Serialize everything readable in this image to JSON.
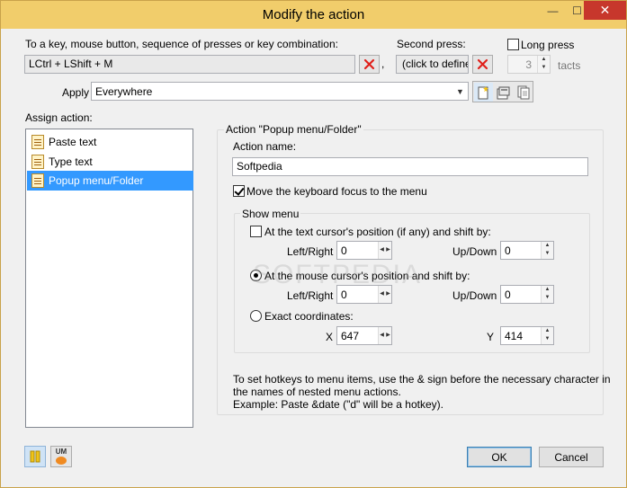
{
  "window": {
    "title": "Modify the action",
    "minimize_glyph": "—",
    "maximize_glyph": "☐",
    "close_glyph": "✕"
  },
  "top": {
    "key_label": "To a key, mouse button, sequence of presses or key combination:",
    "key_value": "LCtrl + LShift + M",
    "comma": ",",
    "second_press_label": "Second press:",
    "second_press_value": "(click to define)",
    "long_press_label": "Long press",
    "long_press_checked": false,
    "tacts_value": "3",
    "tacts_label": "tacts"
  },
  "apply": {
    "label": "Apply",
    "value": "Everywhere",
    "icons": [
      "new-icon",
      "properties-icon",
      "copy-icon"
    ]
  },
  "assign": {
    "label": "Assign action:",
    "items": [
      {
        "label": "Paste text",
        "icon": "paste-text-icon",
        "selected": false
      },
      {
        "label": "Type text",
        "icon": "type-text-icon",
        "selected": false
      },
      {
        "label": "Popup menu/Folder",
        "icon": "popup-menu-icon",
        "selected": true
      }
    ]
  },
  "action_group": {
    "title": "Action \"Popup menu/Folder\"",
    "name_label": "Action name:",
    "name_value": "Softpedia",
    "focus_label": "Move the keyboard focus to the menu",
    "focus_checked": true
  },
  "show_menu": {
    "title": "Show menu",
    "text_cursor_label": "At the text cursor's position (if any) and shift by:",
    "text_cursor_checked": false,
    "mouse_cursor_label": "At the mouse cursor's position and shift by:",
    "mouse_cursor_selected": true,
    "exact_label": "Exact coordinates:",
    "exact_selected": false,
    "left_right_label": "Left/Right",
    "up_down_label": "Up/Down",
    "tc_left_right": "0",
    "tc_up_down": "0",
    "mc_left_right": "0",
    "mc_up_down": "0",
    "x_label": "X",
    "x_value": "647",
    "y_label": "Y",
    "y_value": "414"
  },
  "hint": {
    "line1": "To set hotkeys to menu items, use the & sign before the necessary character in",
    "line2": "the names of nested menu actions.",
    "line3": "Example: Paste &date (\"d\" will be a hotkey)."
  },
  "bottom": {
    "um_label": "UM",
    "ok_label": "OK",
    "cancel_label": "Cancel"
  },
  "watermark": "SOFTPEDIA",
  "colors": {
    "titlebar": "#f1cd6b",
    "close": "#c7372c",
    "selection": "#3399ff",
    "x_icon": "#e0201b"
  }
}
